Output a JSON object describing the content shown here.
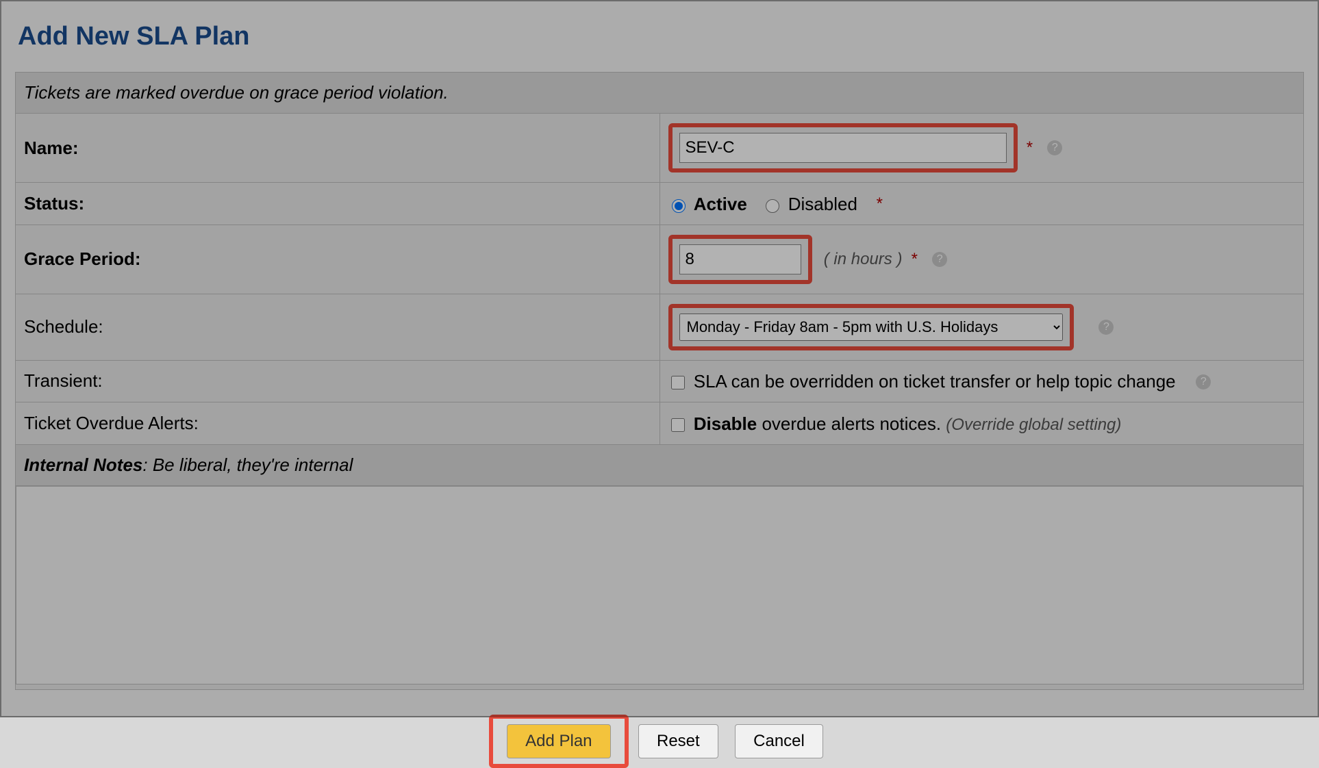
{
  "page": {
    "title": "Add New SLA Plan"
  },
  "form": {
    "header_note": "Tickets are marked overdue on grace period violation.",
    "name": {
      "label": "Name:",
      "value": "SEV-C"
    },
    "status": {
      "label": "Status:",
      "active_label": "Active",
      "disabled_label": "Disabled",
      "selected": "active"
    },
    "grace": {
      "label": "Grace Period:",
      "value": "8",
      "hint": "( in hours )"
    },
    "schedule": {
      "label": "Schedule:",
      "selected": "Monday - Friday 8am - 5pm with U.S. Holidays"
    },
    "transient": {
      "label": "Transient:",
      "checkbox_label": "SLA can be overridden on ticket transfer or help topic change",
      "checked": false
    },
    "overdue_alerts": {
      "label": "Ticket Overdue Alerts:",
      "bold_word": "Disable",
      "rest_label": " overdue alerts notices. ",
      "hint": "(Override global setting)",
      "checked": false
    },
    "notes": {
      "header_bold": "Internal Notes",
      "header_rest": ": Be liberal, they're internal",
      "value": ""
    }
  },
  "buttons": {
    "add": "Add Plan",
    "reset": "Reset",
    "cancel": "Cancel"
  },
  "misc": {
    "required_marker": "*",
    "help_glyph": "?"
  }
}
